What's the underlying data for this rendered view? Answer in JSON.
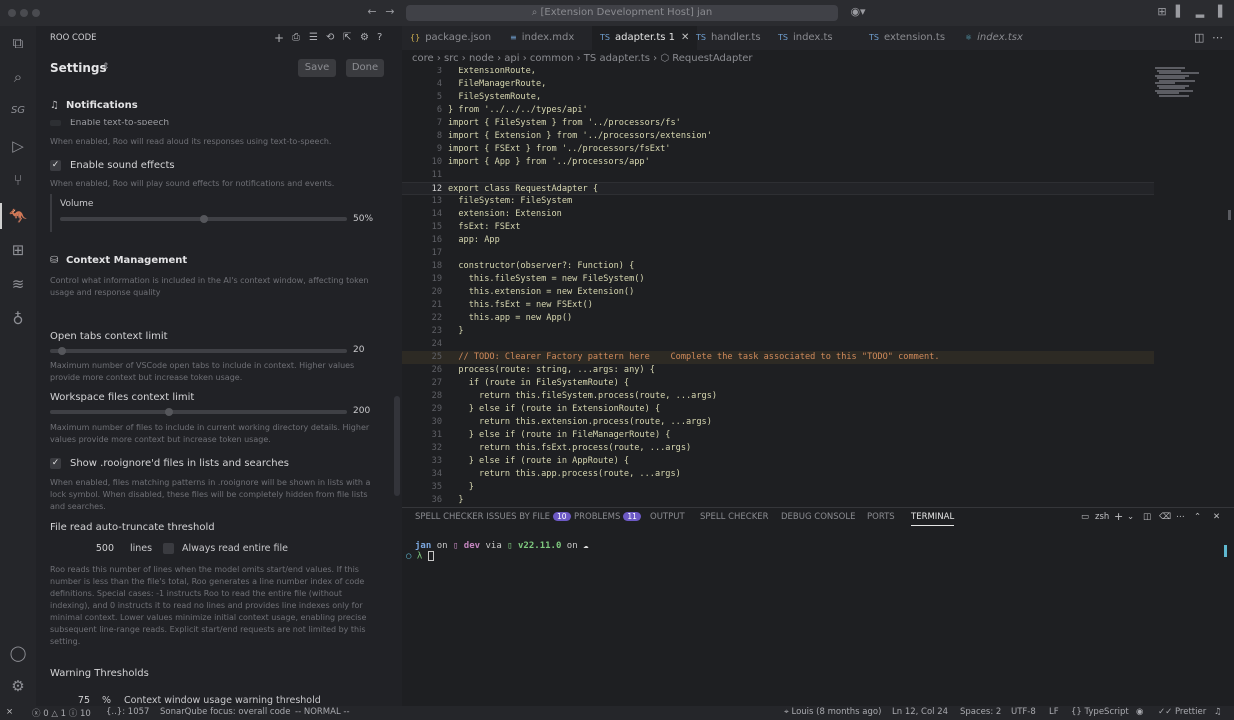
{
  "window": {
    "search_text": "[Extension Development Host] jan"
  },
  "panel": {
    "title": "ROO CODE",
    "settings_title": "Settings",
    "save_label": "Save",
    "done_label": "Done",
    "notifications_heading": "Notifications",
    "tts_partial_label": "Enable text-to-speech",
    "tts_desc": "When enabled, Roo will read aloud its responses using text-to-speech.",
    "sound_label": "Enable sound effects",
    "sound_desc": "When enabled, Roo will play sound effects for notifications and events.",
    "volume_label": "Volume",
    "volume_value": "50%",
    "volume_fraction": 0.5,
    "context_heading": "Context Management",
    "context_desc": "Control what information is included in the AI's context window, affecting token usage and response quality",
    "open_tabs_label": "Open tabs context limit",
    "open_tabs_value": "20",
    "open_tabs_fraction": 0.04,
    "open_tabs_desc": "Maximum number of VSCode open tabs to include in context. Higher values provide more context but increase token usage.",
    "workspace_label": "Workspace files context limit",
    "workspace_value": "200",
    "workspace_fraction": 0.4,
    "workspace_desc": "Maximum number of files to include in current working directory details. Higher values provide more context but increase token usage.",
    "rooignore_label": "Show .rooignore'd files in lists and searches",
    "rooignore_desc": "When enabled, files matching patterns in .rooignore will be shown in lists with a lock symbol. When disabled, these files will be completely hidden from file lists and searches.",
    "truncate_label": "File read auto-truncate threshold",
    "truncate_value": "500",
    "truncate_unit": "lines",
    "always_read_label": "Always read entire file",
    "truncate_desc": "Roo reads this number of lines when the model omits start/end values. If this number is less than the file's total, Roo generates a line number index of code definitions. Special cases: -1 instructs Roo to read the entire file (without indexing), and 0 instructs it to read no lines and provides line indexes only for minimal context. Lower values minimize initial context usage, enabling precise subsequent line-range reads. Explicit start/end requests are not limited by this setting.",
    "warning_heading": "Warning Thresholds",
    "warning_value": "75",
    "warning_unit": "%",
    "warning_label": "Context window usage warning threshold"
  },
  "tabs": [
    {
      "label": "package.json",
      "icon": "{}"
    },
    {
      "label": "index.mdx",
      "icon": "≡"
    },
    {
      "label": "adapter.ts 1",
      "icon": "TS"
    },
    {
      "label": "handler.ts",
      "icon": "TS"
    },
    {
      "label": "index.ts",
      "icon": "TS"
    },
    {
      "label": "extension.ts",
      "icon": "TS"
    },
    {
      "label": "index.tsx",
      "icon": "⚛"
    }
  ],
  "breadcrumb": {
    "text": "core  ›  src  ›  node  ›  api  ›  common  ›  TS adapter.ts  ›  ⬡ RequestAdapter"
  },
  "code": [
    {
      "n": "3",
      "t": "  ExtensionRoute,"
    },
    {
      "n": "4",
      "t": "  FileManagerRoute,"
    },
    {
      "n": "5",
      "t": "  FileSystemRoute,"
    },
    {
      "n": "6",
      "t": "} from '../../../types/api'"
    },
    {
      "n": "7",
      "t": "import { FileSystem } from '../processors/fs'"
    },
    {
      "n": "8",
      "t": "import { Extension } from '../processors/extension'"
    },
    {
      "n": "9",
      "t": "import { FSExt } from '../processors/fsExt'"
    },
    {
      "n": "10",
      "t": "import { App } from '../processors/app'"
    },
    {
      "n": "11",
      "t": ""
    },
    {
      "n": "12",
      "t": "export class RequestAdapter {"
    },
    {
      "n": "13",
      "t": "  fileSystem: FileSystem"
    },
    {
      "n": "14",
      "t": "  extension: Extension"
    },
    {
      "n": "15",
      "t": "  fsExt: FSExt"
    },
    {
      "n": "16",
      "t": "  app: App"
    },
    {
      "n": "17",
      "t": ""
    },
    {
      "n": "18",
      "t": "  constructor(observer?: Function) {"
    },
    {
      "n": "19",
      "t": "    this.fileSystem = new FileSystem()"
    },
    {
      "n": "20",
      "t": "    this.extension = new Extension()"
    },
    {
      "n": "21",
      "t": "    this.fsExt = new FSExt()"
    },
    {
      "n": "22",
      "t": "    this.app = new App()"
    },
    {
      "n": "23",
      "t": "  }"
    },
    {
      "n": "24",
      "t": ""
    },
    {
      "n": "25",
      "t": "  // TODO: Clearer Factory pattern here    Complete the task associated to this \"TODO\" comment."
    },
    {
      "n": "26",
      "t": "  process(route: string, ...args: any) {"
    },
    {
      "n": "27",
      "t": "    if (route in FileSystemRoute) {"
    },
    {
      "n": "28",
      "t": "      return this.fileSystem.process(route, ...args)"
    },
    {
      "n": "29",
      "t": "    } else if (route in ExtensionRoute) {"
    },
    {
      "n": "30",
      "t": "      return this.extension.process(route, ...args)"
    },
    {
      "n": "31",
      "t": "    } else if (route in FileManagerRoute) {"
    },
    {
      "n": "32",
      "t": "      return this.fsExt.process(route, ...args)"
    },
    {
      "n": "33",
      "t": "    } else if (route in AppRoute) {"
    },
    {
      "n": "34",
      "t": "      return this.app.process(route, ...args)"
    },
    {
      "n": "35",
      "t": "    }"
    },
    {
      "n": "36",
      "t": "  }"
    }
  ],
  "bottom_panel": {
    "spell_issues_label": "SPELL CHECKER ISSUES BY FILE",
    "spell_issues_count": "10",
    "problems_label": "PROBLEMS",
    "problems_count": "11",
    "output_label": "OUTPUT",
    "spell_checker_label": "SPELL CHECKER",
    "debug_label": "DEBUG CONSOLE",
    "ports_label": "PORTS",
    "terminal_label": "TERMINAL",
    "shell_label": "zsh",
    "prompt_user": "jan",
    "prompt_on": "on",
    "prompt_branch": "dev",
    "prompt_via": "via",
    "prompt_node": "v22.11.0",
    "prompt_on2": "on",
    "prompt_symbol": "λ"
  },
  "status": {
    "errors": "0",
    "warnings": "1",
    "info": "10",
    "brackets": "{..}: 1057",
    "sonar": "SonarQube focus: overall code",
    "mode": "-- NORMAL --",
    "git_blame": "Louis (8 months ago)",
    "position": "Ln 12, Col 24",
    "spaces": "Spaces: 2",
    "encoding": "UTF-8",
    "eol": "LF",
    "language": "TypeScript",
    "prettier": "Prettier"
  },
  "colors": {
    "accent": "#6c59c4",
    "keyword": "#c586c0",
    "type": "#7ec8a4",
    "string": "#d7d7b0",
    "todo_bg": "#d8d8d8"
  }
}
